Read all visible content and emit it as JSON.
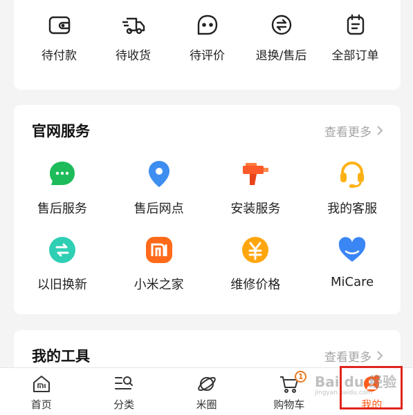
{
  "orders": {
    "items": [
      {
        "label": "待付款",
        "icon": "wallet-icon"
      },
      {
        "label": "待收货",
        "icon": "truck-icon"
      },
      {
        "label": "待评价",
        "icon": "comment-icon"
      },
      {
        "label": "退换/售后",
        "icon": "exchange-icon"
      },
      {
        "label": "全部订单",
        "icon": "order-list-icon"
      }
    ]
  },
  "services": {
    "title": "官网服务",
    "more": "查看更多",
    "items": [
      {
        "label": "售后服务",
        "icon": "chat-bubble-icon",
        "color": "#1dbb5a"
      },
      {
        "label": "售后网点",
        "icon": "location-pin-icon",
        "color": "#3d8ef0"
      },
      {
        "label": "安装服务",
        "icon": "drill-icon",
        "color": "#ff5a2a"
      },
      {
        "label": "我的客服",
        "icon": "headset-icon",
        "color": "#ffb114"
      },
      {
        "label": "以旧换新",
        "icon": "trade-in-icon",
        "color": "#2fcfb4"
      },
      {
        "label": "小米之家",
        "icon": "mi-logo-icon",
        "color": "#ff6a1a"
      },
      {
        "label": "维修价格",
        "icon": "yuan-coin-icon",
        "color": "#ffa60e"
      },
      {
        "label": "MiCare",
        "icon": "heart-icon",
        "color": "#3a86f5"
      }
    ]
  },
  "tools": {
    "title": "我的工具",
    "more": "查看更多"
  },
  "tabbar": {
    "items": [
      {
        "label": "首页",
        "icon": "home-icon"
      },
      {
        "label": "分类",
        "icon": "category-icon"
      },
      {
        "label": "米圈",
        "icon": "planet-icon"
      },
      {
        "label": "购物车",
        "icon": "cart-icon",
        "badge": "1"
      },
      {
        "label": "我的",
        "icon": "profile-icon",
        "active": true
      }
    ]
  },
  "watermark": {
    "text": "Bai du 经验",
    "url": "jingyan.baidu.com"
  },
  "colors": {
    "accent": "#ff5b1a",
    "highlight": "#e0241b"
  }
}
